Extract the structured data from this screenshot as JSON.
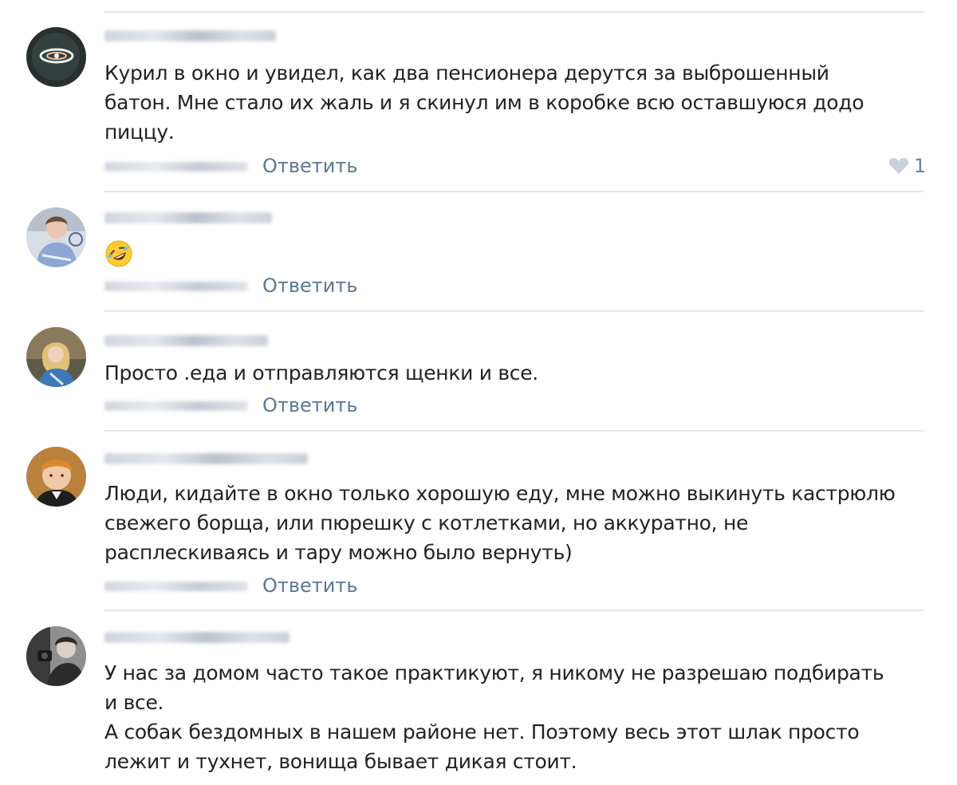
{
  "comments": [
    {
      "text_lines": [
        "Курил в окно и увидел, как два пенсионера дерутся за выброшенный",
        "батон. Мне стало их жаль и я скинул им в коробке всю оставшуюся додо",
        "пиццу."
      ],
      "reply_label": "Ответить",
      "likes": "1"
    },
    {
      "text_lines": [],
      "emoji": "rolling-on-floor-laughing",
      "reply_label": "Ответить"
    },
    {
      "text_lines": [
        "Просто .еда и отправляются щенки и все."
      ],
      "reply_label": "Ответить"
    },
    {
      "text_lines": [
        "Люди, кидайте в окно только хорошую еду, мне можно выкинуть кастрюлю",
        "свежего борща, или пюрешку с котлетками, но аккуратно, не",
        "расплескиваясь и тару можно было вернуть)"
      ],
      "reply_label": "Ответить"
    },
    {
      "text_lines": [
        "У нас за домом часто такое практикуют, я никому не разрешаю подбирать",
        "и все.",
        "А собак бездомных в нашем районе нет. Поэтому весь этот шлак просто",
        "лежит и тухнет, вонища бывает дикая стоит."
      ]
    }
  ],
  "colors": {
    "link": "#5b7796",
    "divider": "#e3e6ea",
    "text": "#202225"
  }
}
